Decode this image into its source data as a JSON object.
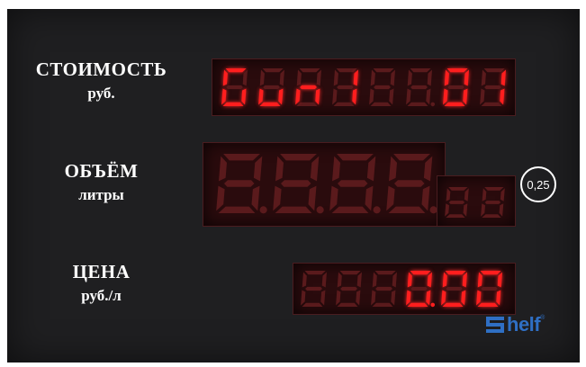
{
  "rows": [
    {
      "title": "СТОИМОСТЬ",
      "unit": "руб.",
      "display": "Gun1  01"
    },
    {
      "title": "ОБЪЁМ",
      "unit": "литры",
      "display": ""
    },
    {
      "title": "ЦЕНА",
      "unit": "руб./л",
      "display": "0.00"
    }
  ],
  "badge": "0,25",
  "logo": {
    "text": "helf",
    "registered": "®"
  },
  "colors": {
    "lit": "#ff1e1e",
    "unlit": "#5a1a1c",
    "panel": "#1f1f21",
    "logo": "#2f6fc4"
  }
}
